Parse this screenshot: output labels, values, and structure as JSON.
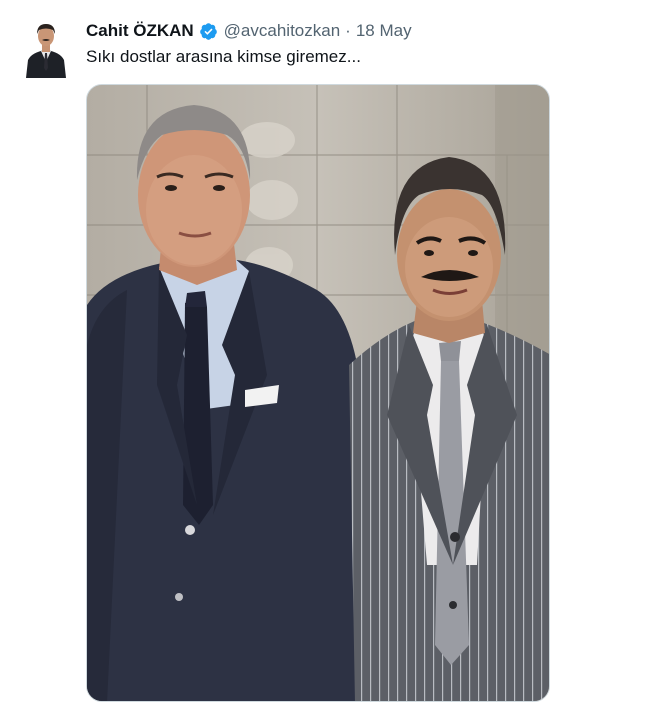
{
  "tweet": {
    "display_name": "Cahit ÖZKAN",
    "handle": "@avcahitozkan",
    "separator": "·",
    "date": "18 May",
    "text": "Sıkı dostlar arasına kimse giremez...",
    "verified": true,
    "icons": {
      "verified": "verified-badge-icon",
      "avatar": "profile-avatar"
    },
    "colors": {
      "verified_badge": "#1d9bf0",
      "name_text": "#0f1419",
      "secondary_text": "#536471"
    }
  }
}
